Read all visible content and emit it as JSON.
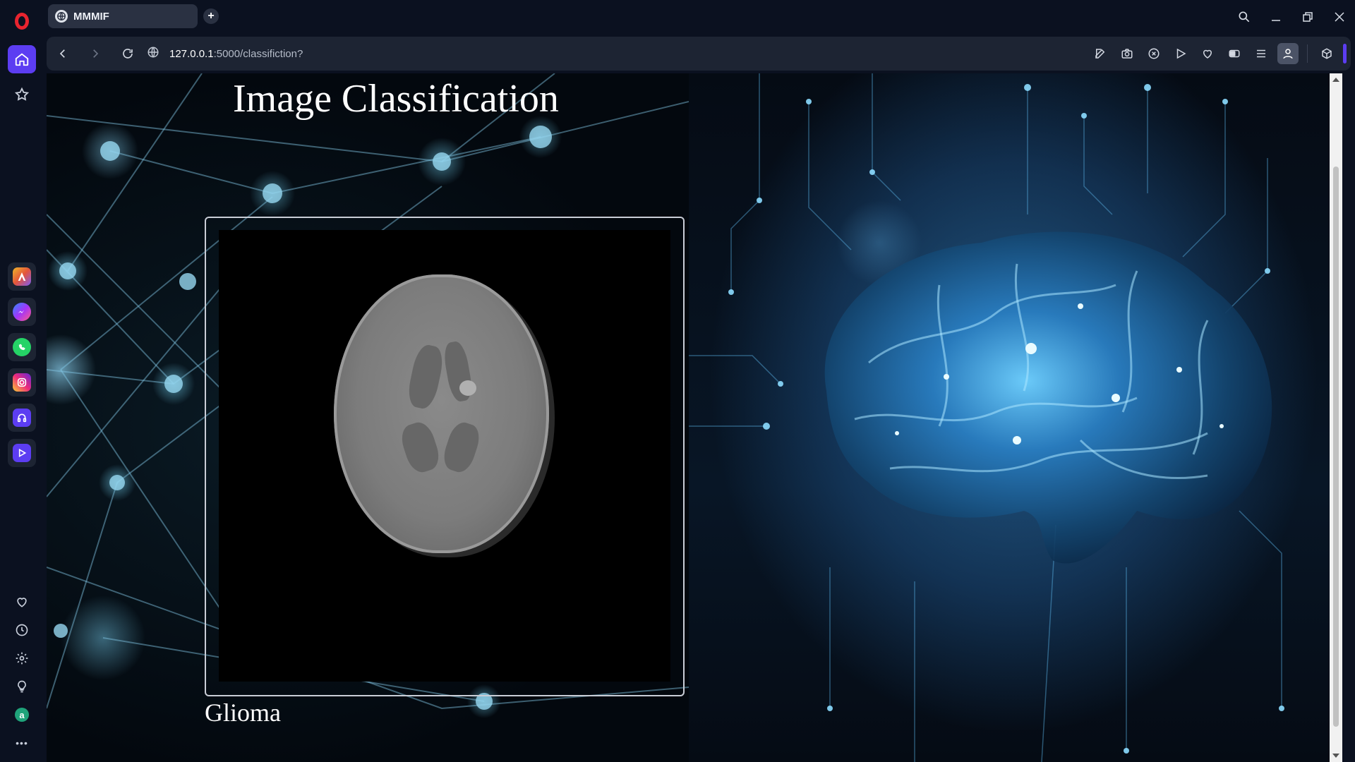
{
  "browser": {
    "tab_title": "MMMIF",
    "new_tab_symbol": "+",
    "url_host": "127.0.0.1",
    "url_rest": ":5000/classifiction?"
  },
  "sidebar": {
    "apps": [
      {
        "name": "aria-icon",
        "color": "#e4553b"
      },
      {
        "name": "messenger-icon",
        "color": "#7b5cf5"
      },
      {
        "name": "whatsapp-icon",
        "color": "#25d366"
      },
      {
        "name": "instagram-icon",
        "color": "#e1306c"
      },
      {
        "name": "music-player-icon",
        "color": "#5c3df2"
      },
      {
        "name": "player-icon",
        "color": "#5c3df2"
      }
    ],
    "more": "•••"
  },
  "page": {
    "title": "Image Classification",
    "result": "Glioma"
  },
  "colors": {
    "accent": "#5c3df2",
    "opera_red": "#e8242f"
  }
}
